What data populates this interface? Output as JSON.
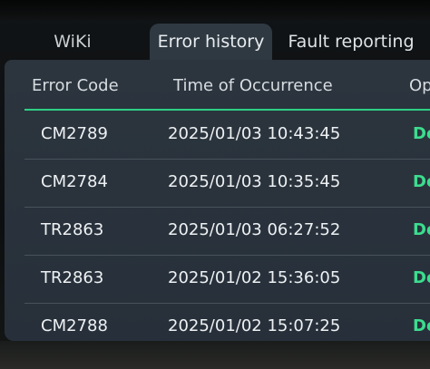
{
  "tabs": [
    {
      "label": "WiKi",
      "active": false
    },
    {
      "label": "Error history",
      "active": true
    },
    {
      "label": "Fault reporting",
      "active": false
    }
  ],
  "table": {
    "headers": [
      "Error Code",
      "Time of Occurrence",
      "Op"
    ],
    "rows": [
      {
        "code": "CM2789",
        "time": "2025/01/03 10:43:45",
        "op": "De"
      },
      {
        "code": "CM2784",
        "time": "2025/01/03 10:35:45",
        "op": "De"
      },
      {
        "code": "TR2863",
        "time": "2025/01/03 06:27:52",
        "op": "De"
      },
      {
        "code": "TR2863",
        "time": "2025/01/02 15:36:05",
        "op": "De"
      },
      {
        "code": "CM2788",
        "time": "2025/01/02 15:07:25",
        "op": "De"
      }
    ]
  },
  "colors": {
    "accent": "#2fcf86",
    "action_text": "#3ddc8f",
    "panel": "#2c353e",
    "active_tab": "#2f3942"
  }
}
